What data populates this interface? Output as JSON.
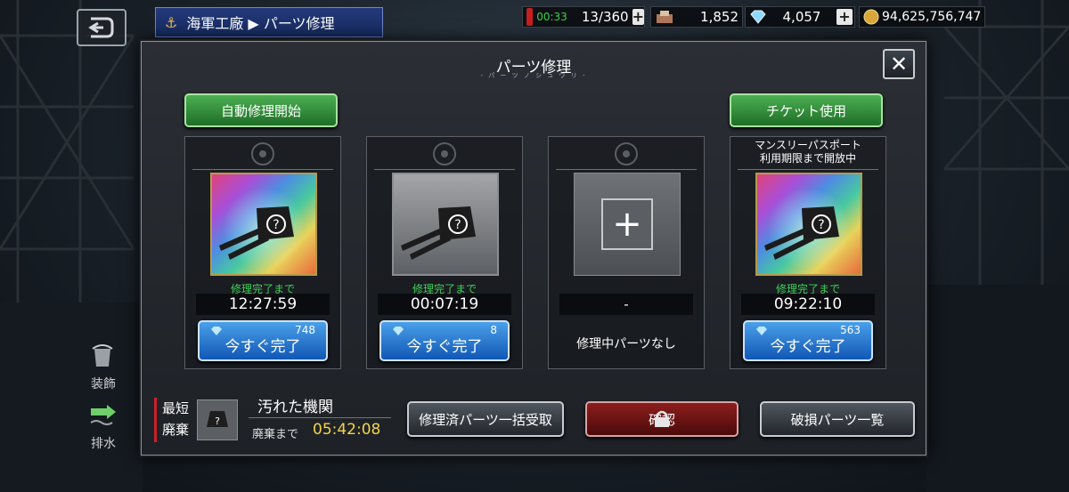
{
  "header": {
    "breadcrumb": "海軍工廠 ▶ パーツ修理",
    "fuel_timer": "00:33",
    "fuel_count": "13/360",
    "material_count": "1,852",
    "gem_count": "4,057",
    "coin_count": "94,625,756,747"
  },
  "side_menu": [
    {
      "label": "装飾"
    },
    {
      "label": "排水"
    }
  ],
  "modal": {
    "title": "パーツ修理",
    "subtitle": "- パ ー ツ ノ シ ュ ウ リ -",
    "auto_repair_label": "自動修理開始",
    "ticket_label": "チケット使用"
  },
  "slots": [
    {
      "status_label": "修理完了まで",
      "timer": "12:27:59",
      "cost": "748",
      "action_label": "今すぐ完了",
      "image": "rainbow-turret-unknown"
    },
    {
      "status_label": "修理完了まで",
      "timer": "00:07:19",
      "cost": "8",
      "action_label": "今すぐ完了",
      "image": "grey-turret-unknown"
    },
    {
      "timer": "-",
      "empty_label": "修理中パーツなし",
      "image": "empty-add-slot"
    },
    {
      "note": "マンスリーパスポート\n利用期限まで開放中",
      "status_label": "修理完了まで",
      "timer": "09:22:10",
      "cost": "563",
      "action_label": "今すぐ完了",
      "image": "rainbow-turret-unknown"
    }
  ],
  "bottom": {
    "scrap_tag_line1": "最短",
    "scrap_tag_line2": "廃棄",
    "scrap_name": "汚れた機関",
    "scrap_until_label": "廃棄まで",
    "scrap_time": "05:42:08",
    "bulk_receive_label": "修理済パーツ一括受取",
    "confirm_label": "確認",
    "damaged_list_label": "破損パーツ一覧"
  },
  "colors": {
    "accent_green": "#41d05a",
    "timer_yellow": "#f3d34c",
    "button_blue": "#1157b5",
    "button_red": "#8d1e1e"
  }
}
